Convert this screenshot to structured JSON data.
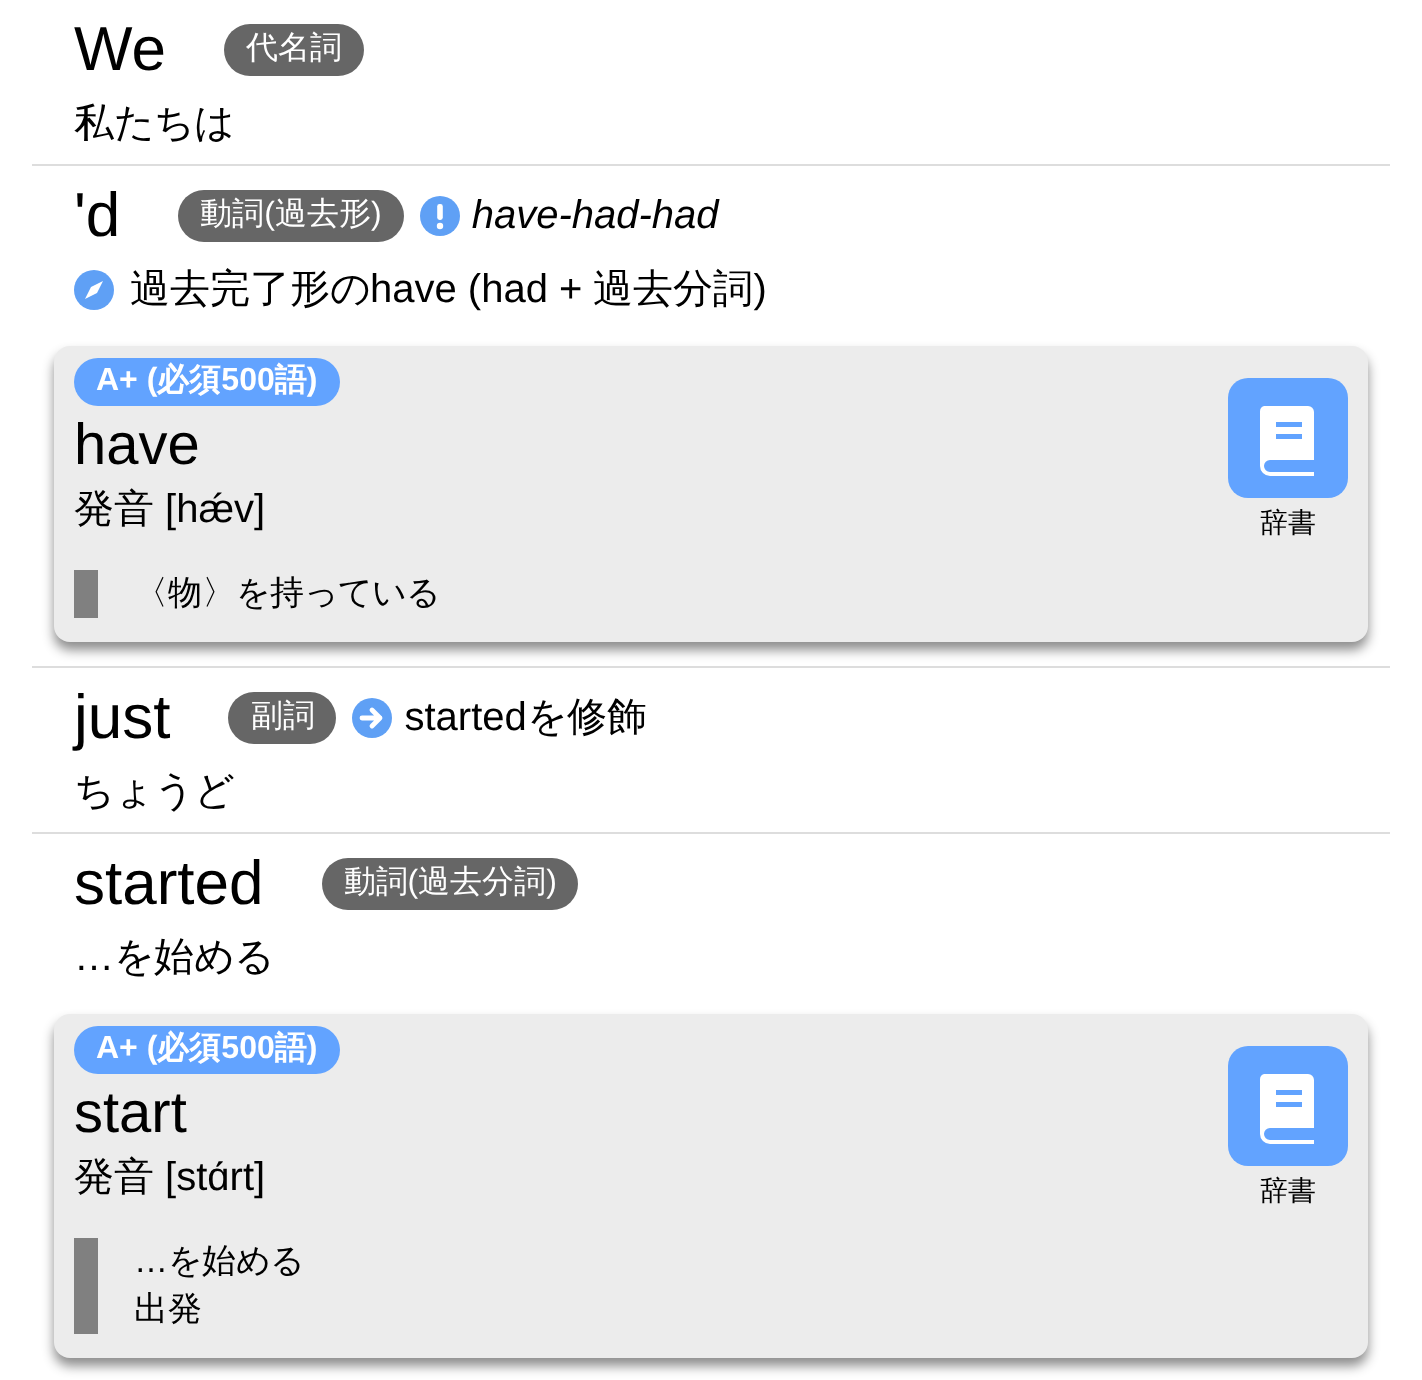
{
  "entries": [
    {
      "word": "We",
      "pos": "代名詞",
      "meaning": {
        "kind": "plain",
        "text": "私たちは"
      }
    },
    {
      "word": "'d",
      "pos": "動詞(過去形)",
      "note": {
        "kind": "irregular",
        "text": "have-had-had"
      },
      "meaning": {
        "kind": "usage",
        "text": "過去完了形のhave (had + 過去分詞)"
      },
      "card": {
        "rank": "A+ (必須500語)",
        "headword": "have",
        "pronunciation": "発音 [hǽv]",
        "senses": [
          "〈物〉を持っている"
        ],
        "button_label": "辞書"
      }
    },
    {
      "word": "just",
      "pos": "副詞",
      "note": {
        "kind": "modifies",
        "text": "startedを修飾"
      },
      "meaning": {
        "kind": "plain",
        "text": "ちょうど"
      }
    },
    {
      "word": "started",
      "pos": "動詞(過去分詞)",
      "meaning": {
        "kind": "plain",
        "text": "…を始める"
      },
      "card": {
        "rank": "A+ (必須500語)",
        "headword": "start",
        "pronunciation": "発音 [stɑ́rt]",
        "senses": [
          "…を始める",
          "出発"
        ],
        "button_label": "辞書"
      }
    }
  ]
}
